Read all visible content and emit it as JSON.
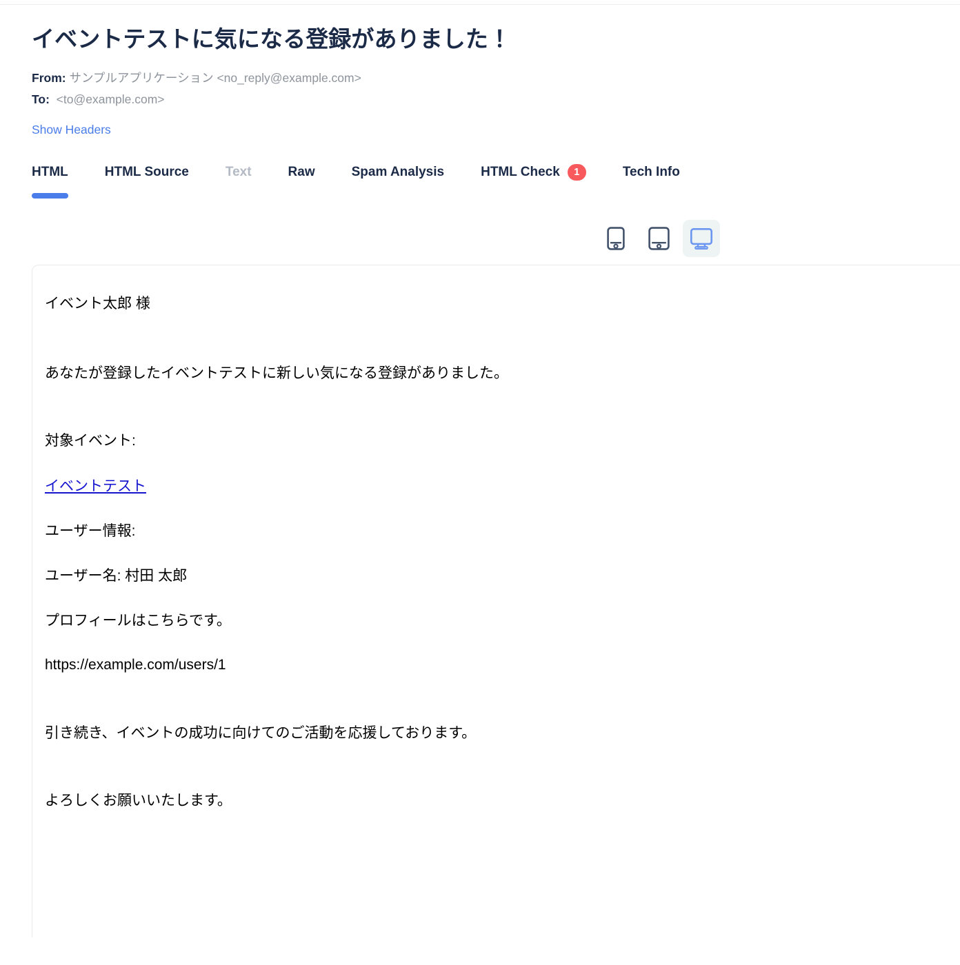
{
  "email_meta": {
    "subject": "イベントテストに気になる登録がありました！",
    "from_label": "From:",
    "from_value": "サンプルアプリケーション <no_reply@example.com>",
    "to_label": "To:",
    "to_value": "<to@example.com>",
    "show_headers_label": "Show Headers"
  },
  "tabs": [
    {
      "label": "HTML",
      "state": "active"
    },
    {
      "label": "HTML Source",
      "state": "normal"
    },
    {
      "label": "Text",
      "state": "disabled"
    },
    {
      "label": "Raw",
      "state": "normal"
    },
    {
      "label": "Spam Analysis",
      "state": "normal"
    },
    {
      "label": "HTML Check",
      "state": "normal",
      "badge": "1"
    },
    {
      "label": "Tech Info",
      "state": "normal"
    }
  ],
  "device_switcher": {
    "mobile_icon": "mobile-icon",
    "tablet_icon": "tablet-icon",
    "desktop_icon": "desktop-icon",
    "selected": "desktop"
  },
  "email_body": {
    "greeting": "イベント太郎 様",
    "intro": "あなたが登録したイベントテストに新しい気になる登録がありました。",
    "event_heading": "対象イベント:",
    "event_link": "イベントテスト",
    "user_info_heading": "ユーザー情報:",
    "user_name": "ユーザー名: 村田 太郎",
    "profile_note": "プロフィールはこちらです。",
    "profile_url": "https://example.com/users/1",
    "closing_1": "引き続き、イベントの成功に向けてのご活動を応援しております。",
    "closing_2": "よろしくお願いいたします。"
  },
  "colors": {
    "accent_blue": "#4a7dea",
    "badge_red": "#f8595d",
    "text_navy": "#1b2a47",
    "text_muted": "#8e949c",
    "text_disabled": "#b3bac4",
    "link_blue": "#1515cf",
    "border_gray": "#e8eaed",
    "active_chip_bg": "#eef4f4"
  }
}
